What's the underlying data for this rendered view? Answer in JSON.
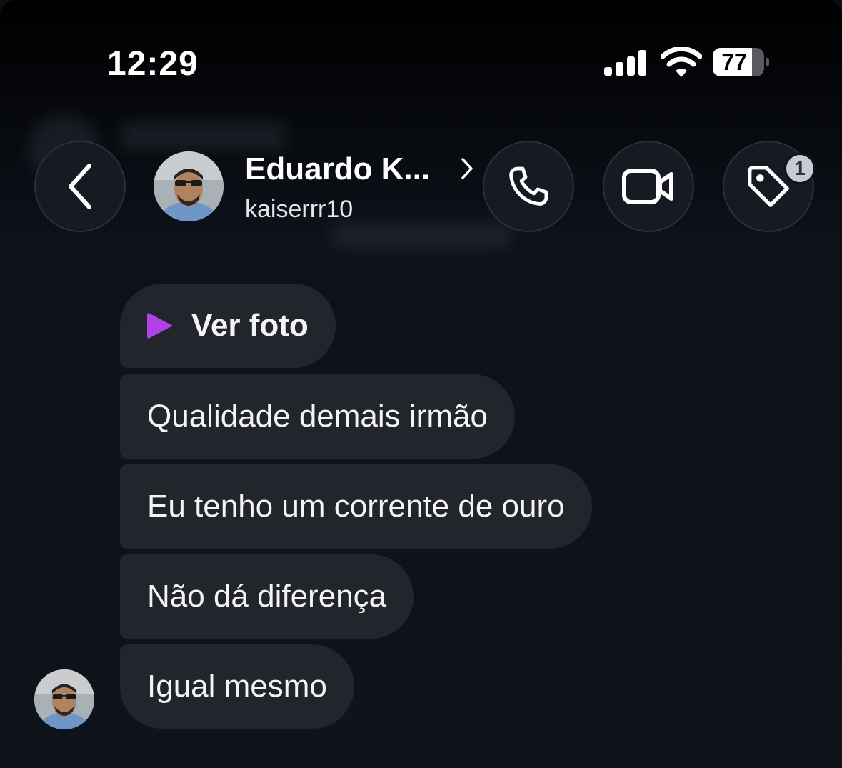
{
  "status_bar": {
    "time": "12:29",
    "battery_percent": 77,
    "battery_label": "77"
  },
  "header": {
    "contact_name": "Eduardo K...",
    "username": "kaiserrr10",
    "tag_badge_count": "1",
    "icons": {
      "back": "chevron-left-icon",
      "name_link": "chevron-right-icon",
      "call": "phone-icon",
      "video": "video-camera-icon",
      "tag": "tag-icon"
    }
  },
  "messages": [
    {
      "type": "media",
      "text": "Ver foto",
      "icon": "play-icon",
      "icon_color": "#b043e8"
    },
    {
      "type": "text",
      "text": "Qualidade demais irmão"
    },
    {
      "type": "text",
      "text": "Eu tenho um corrente de ouro"
    },
    {
      "type": "text",
      "text": "Não dá diferença"
    },
    {
      "type": "text",
      "text": "Igual mesmo"
    }
  ],
  "colors": {
    "background": "#0f131b",
    "bubble": "#22252c",
    "accent_purple": "#b043e8"
  }
}
